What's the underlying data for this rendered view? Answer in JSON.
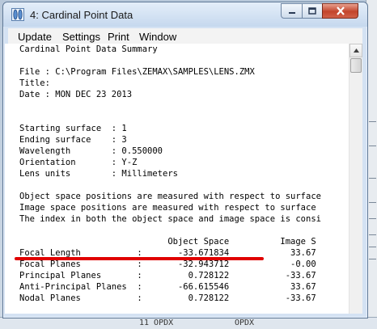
{
  "window": {
    "title": "4: Cardinal Point Data"
  },
  "menu": [
    "Update",
    "Settings",
    "Print",
    "Window"
  ],
  "lines": [
    "Cardinal Point Data Summary",
    "",
    "File : C:\\Program Files\\ZEMAX\\SAMPLES\\LENS.ZMX",
    "Title:",
    "Date : MON DEC 23 2013",
    "",
    "",
    "Starting surface  : 1",
    "Ending surface    : 3",
    "Wavelength        : 0.550000",
    "Orientation       : Y-Z",
    "Lens units        : Millimeters",
    "",
    "Object space positions are measured with respect to surface",
    "Image space positions are measured with respect to surface",
    "The index in both the object space and image space is consi",
    "",
    "                             Object Space          Image S",
    "Focal Length           :       -33.671834            33.67",
    "Focal Planes           :       -32.943712            -0.00",
    "Principal Planes       :         0.728122           -33.67",
    "Anti-Principal Planes  :       -66.615546            33.67",
    "Nodal Planes           :         0.728122           -33.67"
  ],
  "background_bottom": [
    "11  OPDX",
    "OPDX"
  ],
  "colors": {
    "annotation": "#e00000",
    "close_button": "#c3452c"
  }
}
